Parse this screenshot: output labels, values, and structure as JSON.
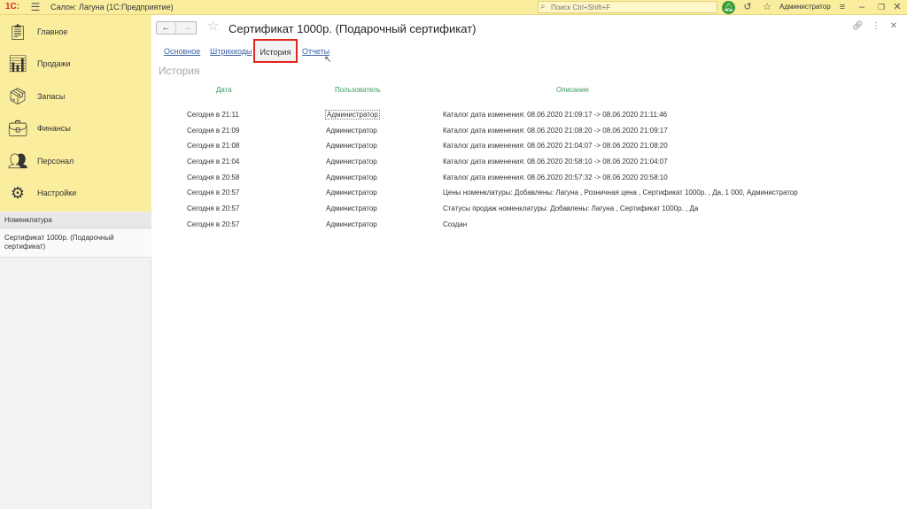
{
  "topbar": {
    "logo": "1С:",
    "app_title": "Салон: Лагуна  (1С:Предприятие)",
    "search_placeholder": "Поиск Ctrl+Shift+F",
    "user": "Администратор"
  },
  "sidebar": {
    "sections": [
      {
        "label": "Главное",
        "icon": "clipboard-icon"
      },
      {
        "label": "Продажи",
        "icon": "chart-icon"
      },
      {
        "label": "Запасы",
        "icon": "inventory-icon"
      },
      {
        "label": "Финансы",
        "icon": "wallet-icon"
      },
      {
        "label": "Персонал",
        "icon": "people-icon"
      },
      {
        "label": "Настройки",
        "icon": "gear-icon"
      }
    ],
    "nav_header": "Номенклатура",
    "nav_item": "Сертификат 1000р. (Подарочный сертификат)"
  },
  "form": {
    "title": "Сертификат 1000р. (Подарочный сертификат)",
    "tabs": [
      "Основное",
      "Штрихкоды",
      "История",
      "Отчеты"
    ],
    "section_title": "История",
    "columns": [
      "Дата",
      "Пользователь",
      "Описание"
    ],
    "rows": [
      {
        "date": "Сегодня в 21:11",
        "user": "Администратор",
        "desc": "Каталог дата изменения: 08.06.2020 21:09:17 -> 08.06.2020 21:11:46"
      },
      {
        "date": "Сегодня в 21:09",
        "user": "Администратор",
        "desc": "Каталог дата изменения: 08.06.2020 21:08:20 -> 08.06.2020 21:09:17"
      },
      {
        "date": "Сегодня в 21:08",
        "user": "Администратор",
        "desc": "Каталог дата изменения: 08.06.2020 21:04:07 -> 08.06.2020 21:08:20"
      },
      {
        "date": "Сегодня в 21:04",
        "user": "Администратор",
        "desc": "Каталог дата изменения: 08.06.2020 20:58:10 -> 08.06.2020 21:04:07"
      },
      {
        "date": "Сегодня в 20:58",
        "user": "Администратор",
        "desc": "Каталог дата изменения: 08.06.2020 20:57:32 -> 08.06.2020 20:58:10"
      },
      {
        "date": "Сегодня в 20:57",
        "user": "Администратор",
        "desc": "Цены номенклатуры: Добавлены: Лагуна , Розничная цена , Сертификат 1000р. , Да, 1 000, Администратор"
      },
      {
        "date": "Сегодня в 20:57",
        "user": "Администратор",
        "desc": "Статусы продаж номенклатуры: Добавлены: Лагуна , Сертификат 1000р. , Да"
      },
      {
        "date": "Сегодня в 20:57",
        "user": "Администратор",
        "desc": "Создан"
      }
    ]
  },
  "colors": {
    "accent_yellow": "#fbed9e",
    "link_blue": "#3a62a6",
    "header_green": "#3a9a62",
    "highlight_red": "#e0271f"
  }
}
